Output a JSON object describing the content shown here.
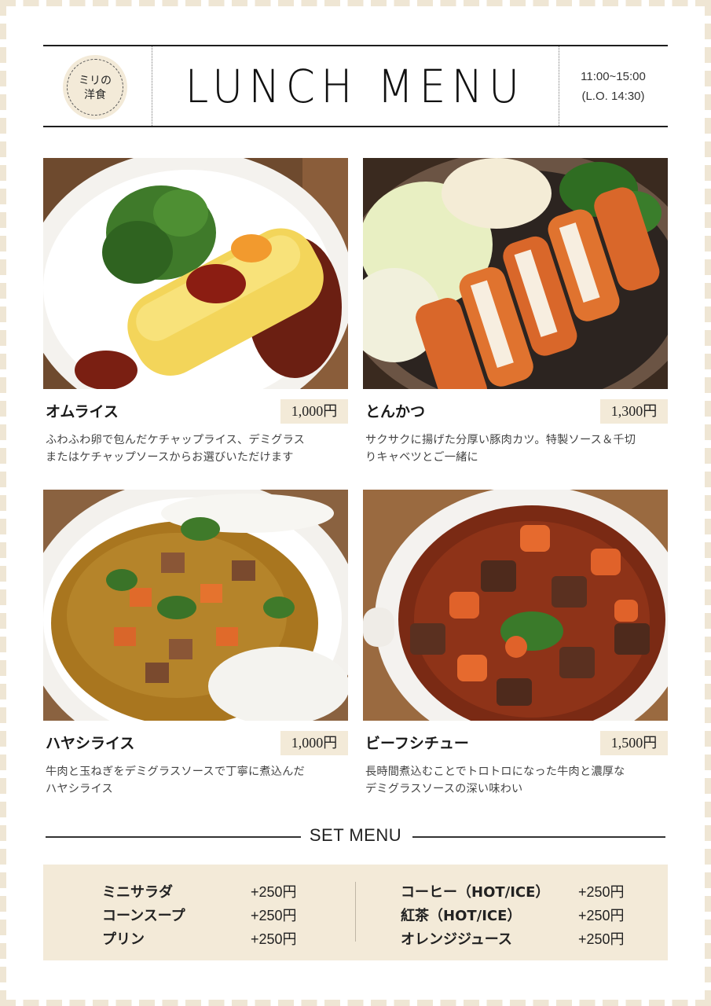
{
  "header": {
    "logo_line1": "ミリの",
    "logo_line2": "洋食",
    "title": "LUNCH MENU",
    "hours": "11:00~15:00",
    "last_order": "(L.O. 14:30)"
  },
  "items": [
    {
      "name": "オムライス",
      "price": "1,000円",
      "desc_line1": "ふわふわ卵で包んだケチャップライス、デミグラス",
      "desc_line2": "またはケチャップソースからお選びいただけます"
    },
    {
      "name": "とんかつ",
      "price": "1,300円",
      "desc_line1": "サクサクに揚げた分厚い豚肉カツ。特製ソース＆千切",
      "desc_line2": "りキャベツとご一緒に"
    },
    {
      "name": "ハヤシライス",
      "price": "1,000円",
      "desc_line1": "牛肉と玉ねぎをデミグラスソースで丁寧に煮込んだ",
      "desc_line2": "ハヤシライス"
    },
    {
      "name": "ビーフシチュー",
      "price": "1,500円",
      "desc_line1": "長時間煮込むことでトロトロになった牛肉と濃厚な",
      "desc_line2": "デミグラスソースの深い味わい"
    }
  ],
  "set_menu": {
    "title": "SET MENU",
    "left": [
      {
        "name": "ミニサラダ",
        "price": "+250円"
      },
      {
        "name": "コーンスープ",
        "price": "+250円"
      },
      {
        "name": "プリン",
        "price": "+250円"
      }
    ],
    "right": [
      {
        "name": "コーヒー（HOT/ICE）",
        "price": "+250円"
      },
      {
        "name": "紅茶（HOT/ICE）",
        "price": "+250円"
      },
      {
        "name": "オレンジジュース",
        "price": "+250円"
      }
    ]
  },
  "colors": {
    "accent_beige": "#f3ead8",
    "frame": "#efe6d4",
    "text": "#222222"
  }
}
